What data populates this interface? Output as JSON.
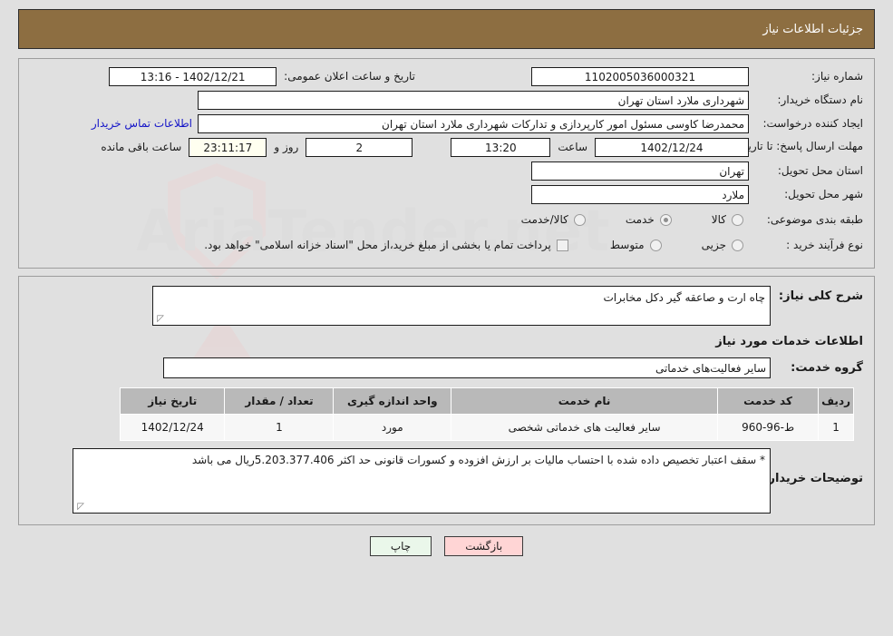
{
  "header": {
    "title": "جزئیات اطلاعات نیاز"
  },
  "info": {
    "need_number_label": "شماره نیاز:",
    "need_number_value": "1102005036000321",
    "announce_label": "تاریخ و ساعت اعلان عمومی:",
    "announce_value": "1402/12/21 - 13:16",
    "buyer_org_label": "نام دستگاه خریدار:",
    "buyer_org_value": "شهرداری ملارد استان تهران",
    "creator_label": "ایجاد کننده درخواست:",
    "creator_value": "محمدرضا کاوسی مسئول امور کارپردازی و تدارکات  شهرداری ملارد استان تهران",
    "contact_link": "اطلاعات تماس خریدار",
    "deadline_label": "مهلت ارسال پاسخ: تا تاریخ:",
    "deadline_date": "1402/12/24",
    "hour_label": "ساعت",
    "deadline_time": "13:20",
    "days_value": "2",
    "days_label": "روز و",
    "countdown_value": "23:11:17",
    "countdown_label": "ساعت باقی مانده",
    "province_label": "استان محل تحویل:",
    "province_value": "تهران",
    "city_label": "شهر محل تحویل:",
    "city_value": "ملارد",
    "category_label": "طبقه بندی موضوعی:",
    "category_options": [
      {
        "label": "کالا",
        "selected": false
      },
      {
        "label": "خدمت",
        "selected": true
      },
      {
        "label": "کالا/خدمت",
        "selected": false
      }
    ],
    "process_label": "نوع فرآیند خرید :",
    "process_options": [
      {
        "label": "جزیی",
        "selected": false
      },
      {
        "label": "متوسط",
        "selected": false
      }
    ],
    "treasury_checkbox_checked": false,
    "treasury_text": "پرداخت تمام یا بخشی از مبلغ خرید،از محل \"اسناد خزانه اسلامی\" خواهد بود."
  },
  "details": {
    "general_desc_label": "شرح کلی نیاز:",
    "general_desc_value": "چاه ارت و صاعقه گیر دکل مخابرات",
    "services_section_title": "اطلاعات خدمات مورد نیاز",
    "service_group_label": "گروه خدمت:",
    "service_group_value": "سایر فعالیت‌های خدماتی",
    "table": {
      "columns": [
        "ردیف",
        "کد خدمت",
        "نام خدمت",
        "واحد اندازه گیری",
        "تعداد / مقدار",
        "تاریخ نیاز"
      ],
      "rows": [
        [
          "1",
          "ط-96-960",
          "سایر فعالیت های خدماتی شخصی",
          "مورد",
          "1",
          "1402/12/24"
        ]
      ]
    },
    "buyer_notes_label": "توضیحات خریدار:",
    "buyer_notes_value": "* سقف اعتبار تخصیص داده شده با احتساب مالیات بر ارزش افزوده و کسورات قانونی حد اکثر 5.203.377.406ریال می باشد"
  },
  "footer": {
    "print_label": "چاپ",
    "back_label": "بازگشت"
  },
  "watermark": {
    "text": "AriaTender.net"
  }
}
